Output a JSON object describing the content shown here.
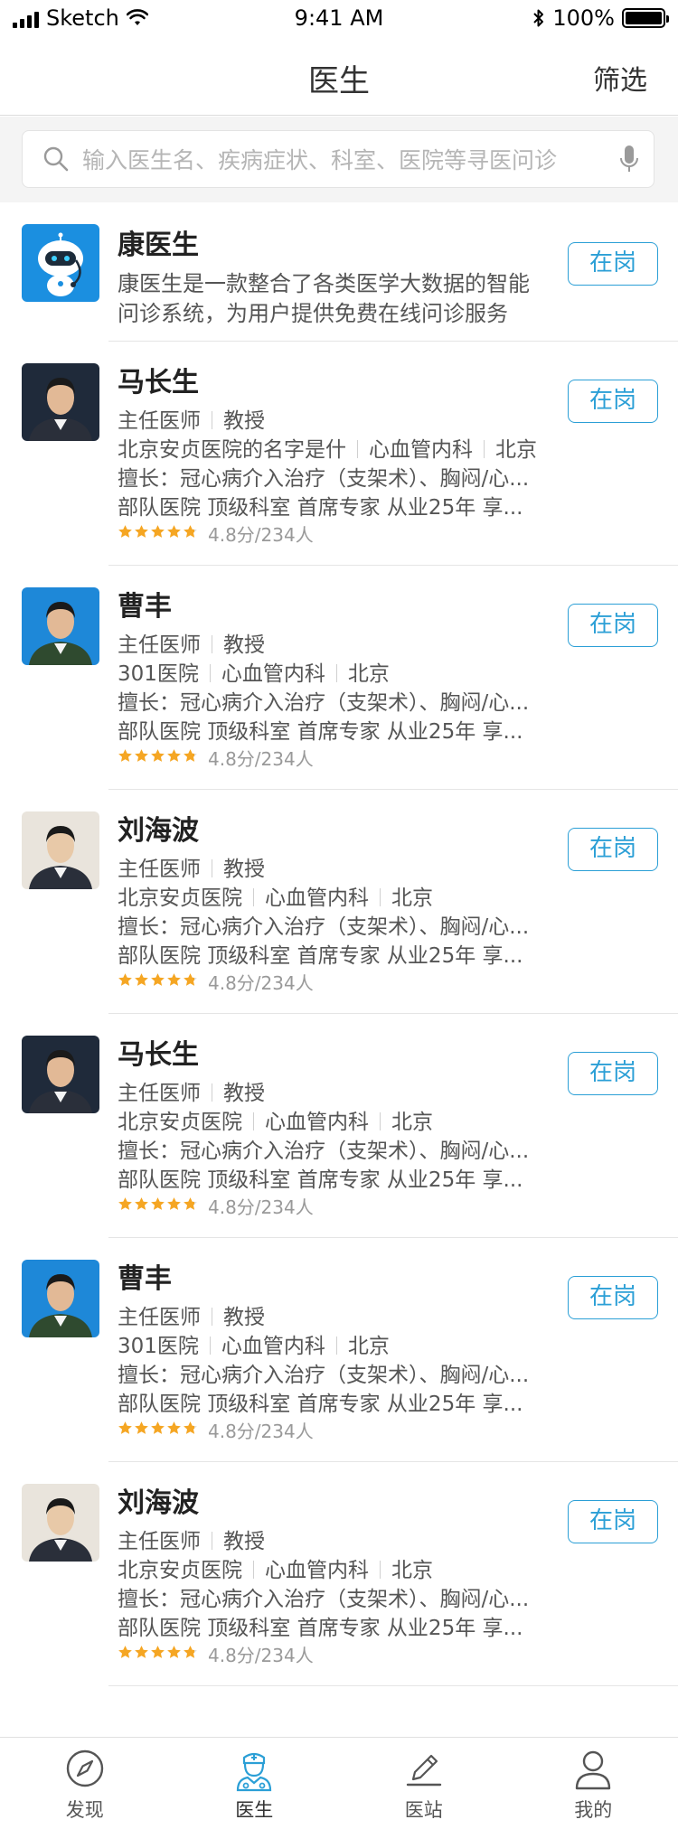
{
  "status_bar": {
    "carrier": "Sketch",
    "time": "9:41 AM",
    "battery": "100%"
  },
  "nav": {
    "title": "医生",
    "filter_label": "筛选"
  },
  "search": {
    "placeholder": "输入医生名、疾病症状、科室、医院等寻医问诊"
  },
  "featured": {
    "name": "康医生",
    "description_line1": "康医生是一款整合了各类医学大数据的智能",
    "description_line2": "问诊系统，为用户提供免费在线问诊服务",
    "status": "在岗",
    "avatar_icon": "robot-icon"
  },
  "doctors": [
    {
      "name": "马长生",
      "title": "主任医师",
      "rank": "教授",
      "hospital": "北京安贞医院的名字是什",
      "department": "心血管内科",
      "city": "北京",
      "specialty": "擅长：冠心病介入治疗（支架术）、胸闷/心...",
      "tags": "部队医院  顶级科室 首席专家 从业25年 享...",
      "rating": 4.8,
      "rating_text": "4.8分/234人",
      "status": "在岗",
      "avatar_bg": "#1f2a3a"
    },
    {
      "name": "曹丰",
      "title": "主任医师",
      "rank": "教授",
      "hospital": "301医院",
      "department": "心血管内科",
      "city": "北京",
      "specialty": "擅长：冠心病介入治疗（支架术）、胸闷/心...",
      "tags": "部队医院  顶级科室 首席专家 从业25年 享...",
      "rating": 4.8,
      "rating_text": "4.8分/234人",
      "status": "在岗",
      "avatar_bg": "#1e88d8"
    },
    {
      "name": "刘海波",
      "title": "主任医师",
      "rank": "教授",
      "hospital": "北京安贞医院",
      "department": "心血管内科",
      "city": "北京",
      "specialty": "擅长：冠心病介入治疗（支架术）、胸闷/心...",
      "tags": "部队医院  顶级科室 首席专家 从业25年 享...",
      "rating": 4.8,
      "rating_text": "4.8分/234人",
      "status": "在岗",
      "avatar_bg": "#e9e4dc"
    },
    {
      "name": "马长生",
      "title": "主任医师",
      "rank": "教授",
      "hospital": "北京安贞医院",
      "department": "心血管内科",
      "city": "北京",
      "specialty": "擅长：冠心病介入治疗（支架术）、胸闷/心...",
      "tags": "部队医院  顶级科室 首席专家 从业25年 享...",
      "rating": 4.8,
      "rating_text": "4.8分/234人",
      "status": "在岗",
      "avatar_bg": "#1f2a3a"
    },
    {
      "name": "曹丰",
      "title": "主任医师",
      "rank": "教授",
      "hospital": "301医院",
      "department": "心血管内科",
      "city": "北京",
      "specialty": "擅长：冠心病介入治疗（支架术）、胸闷/心...",
      "tags": "部队医院  顶级科室 首席专家 从业25年 享...",
      "rating": 4.8,
      "rating_text": "4.8分/234人",
      "status": "在岗",
      "avatar_bg": "#1e88d8"
    },
    {
      "name": "刘海波",
      "title": "主任医师",
      "rank": "教授",
      "hospital": "北京安贞医院",
      "department": "心血管内科",
      "city": "北京",
      "specialty": "擅长：冠心病介入治疗（支架术）、胸闷/心...",
      "tags": "部队医院  顶级科室 首席专家 从业25年 享...",
      "rating": 4.8,
      "rating_text": "4.8分/234人",
      "status": "在岗",
      "avatar_bg": "#e9e4dc"
    }
  ],
  "tabs": [
    {
      "label": "发现",
      "icon": "compass-icon",
      "active": false
    },
    {
      "label": "医生",
      "icon": "nurse-icon",
      "active": true
    },
    {
      "label": "医站",
      "icon": "pen-icon",
      "active": false
    },
    {
      "label": "我的",
      "icon": "person-icon",
      "active": false
    }
  ],
  "colors": {
    "accent": "#2b9fd6",
    "star": "#f5a623",
    "divider": "#e5e5e5"
  }
}
